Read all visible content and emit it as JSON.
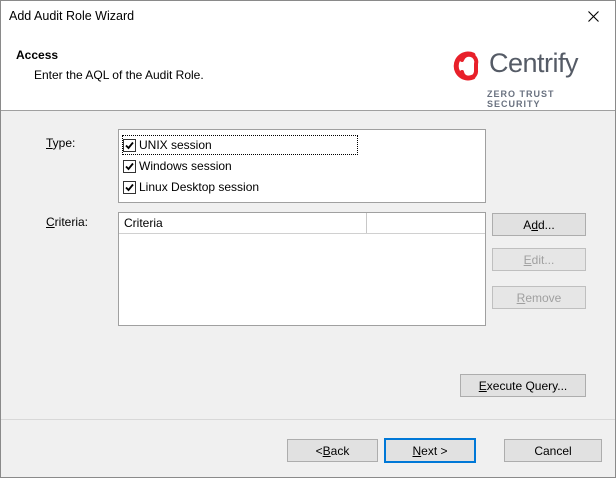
{
  "window": {
    "title": "Add Audit Role Wizard"
  },
  "header": {
    "title": "Access",
    "subtitle": "Enter the AQL of the Audit Role.",
    "logo": {
      "name": "Centrify",
      "tagline": "ZERO TRUST SECURITY",
      "color": "#e8202a"
    }
  },
  "type": {
    "label_accel": "T",
    "label_rest": "ype:",
    "options": [
      {
        "label": "UNIX session",
        "checked": true
      },
      {
        "label": "Windows session",
        "checked": true
      },
      {
        "label": "Linux Desktop session",
        "checked": true
      }
    ]
  },
  "criteria": {
    "label_accel": "C",
    "label_rest": "riteria:",
    "columns": [
      "Criteria",
      ""
    ],
    "rows": []
  },
  "buttons": {
    "add": {
      "pre": "A",
      "accel": "d",
      "post": "d..."
    },
    "edit": {
      "pre": "",
      "accel": "E",
      "post": "dit..."
    },
    "remove": {
      "pre": "",
      "accel": "R",
      "post": "emove"
    },
    "execute": {
      "pre": "",
      "accel": "E",
      "post": "xecute Query..."
    },
    "back": {
      "pre": "< ",
      "accel": "B",
      "post": "ack"
    },
    "next": {
      "pre": "",
      "accel": "N",
      "post": "ext >"
    },
    "cancel": {
      "label": "Cancel"
    }
  },
  "colors": {
    "accent": "#0078d7",
    "dialog_bg": "#f0f0f0"
  }
}
